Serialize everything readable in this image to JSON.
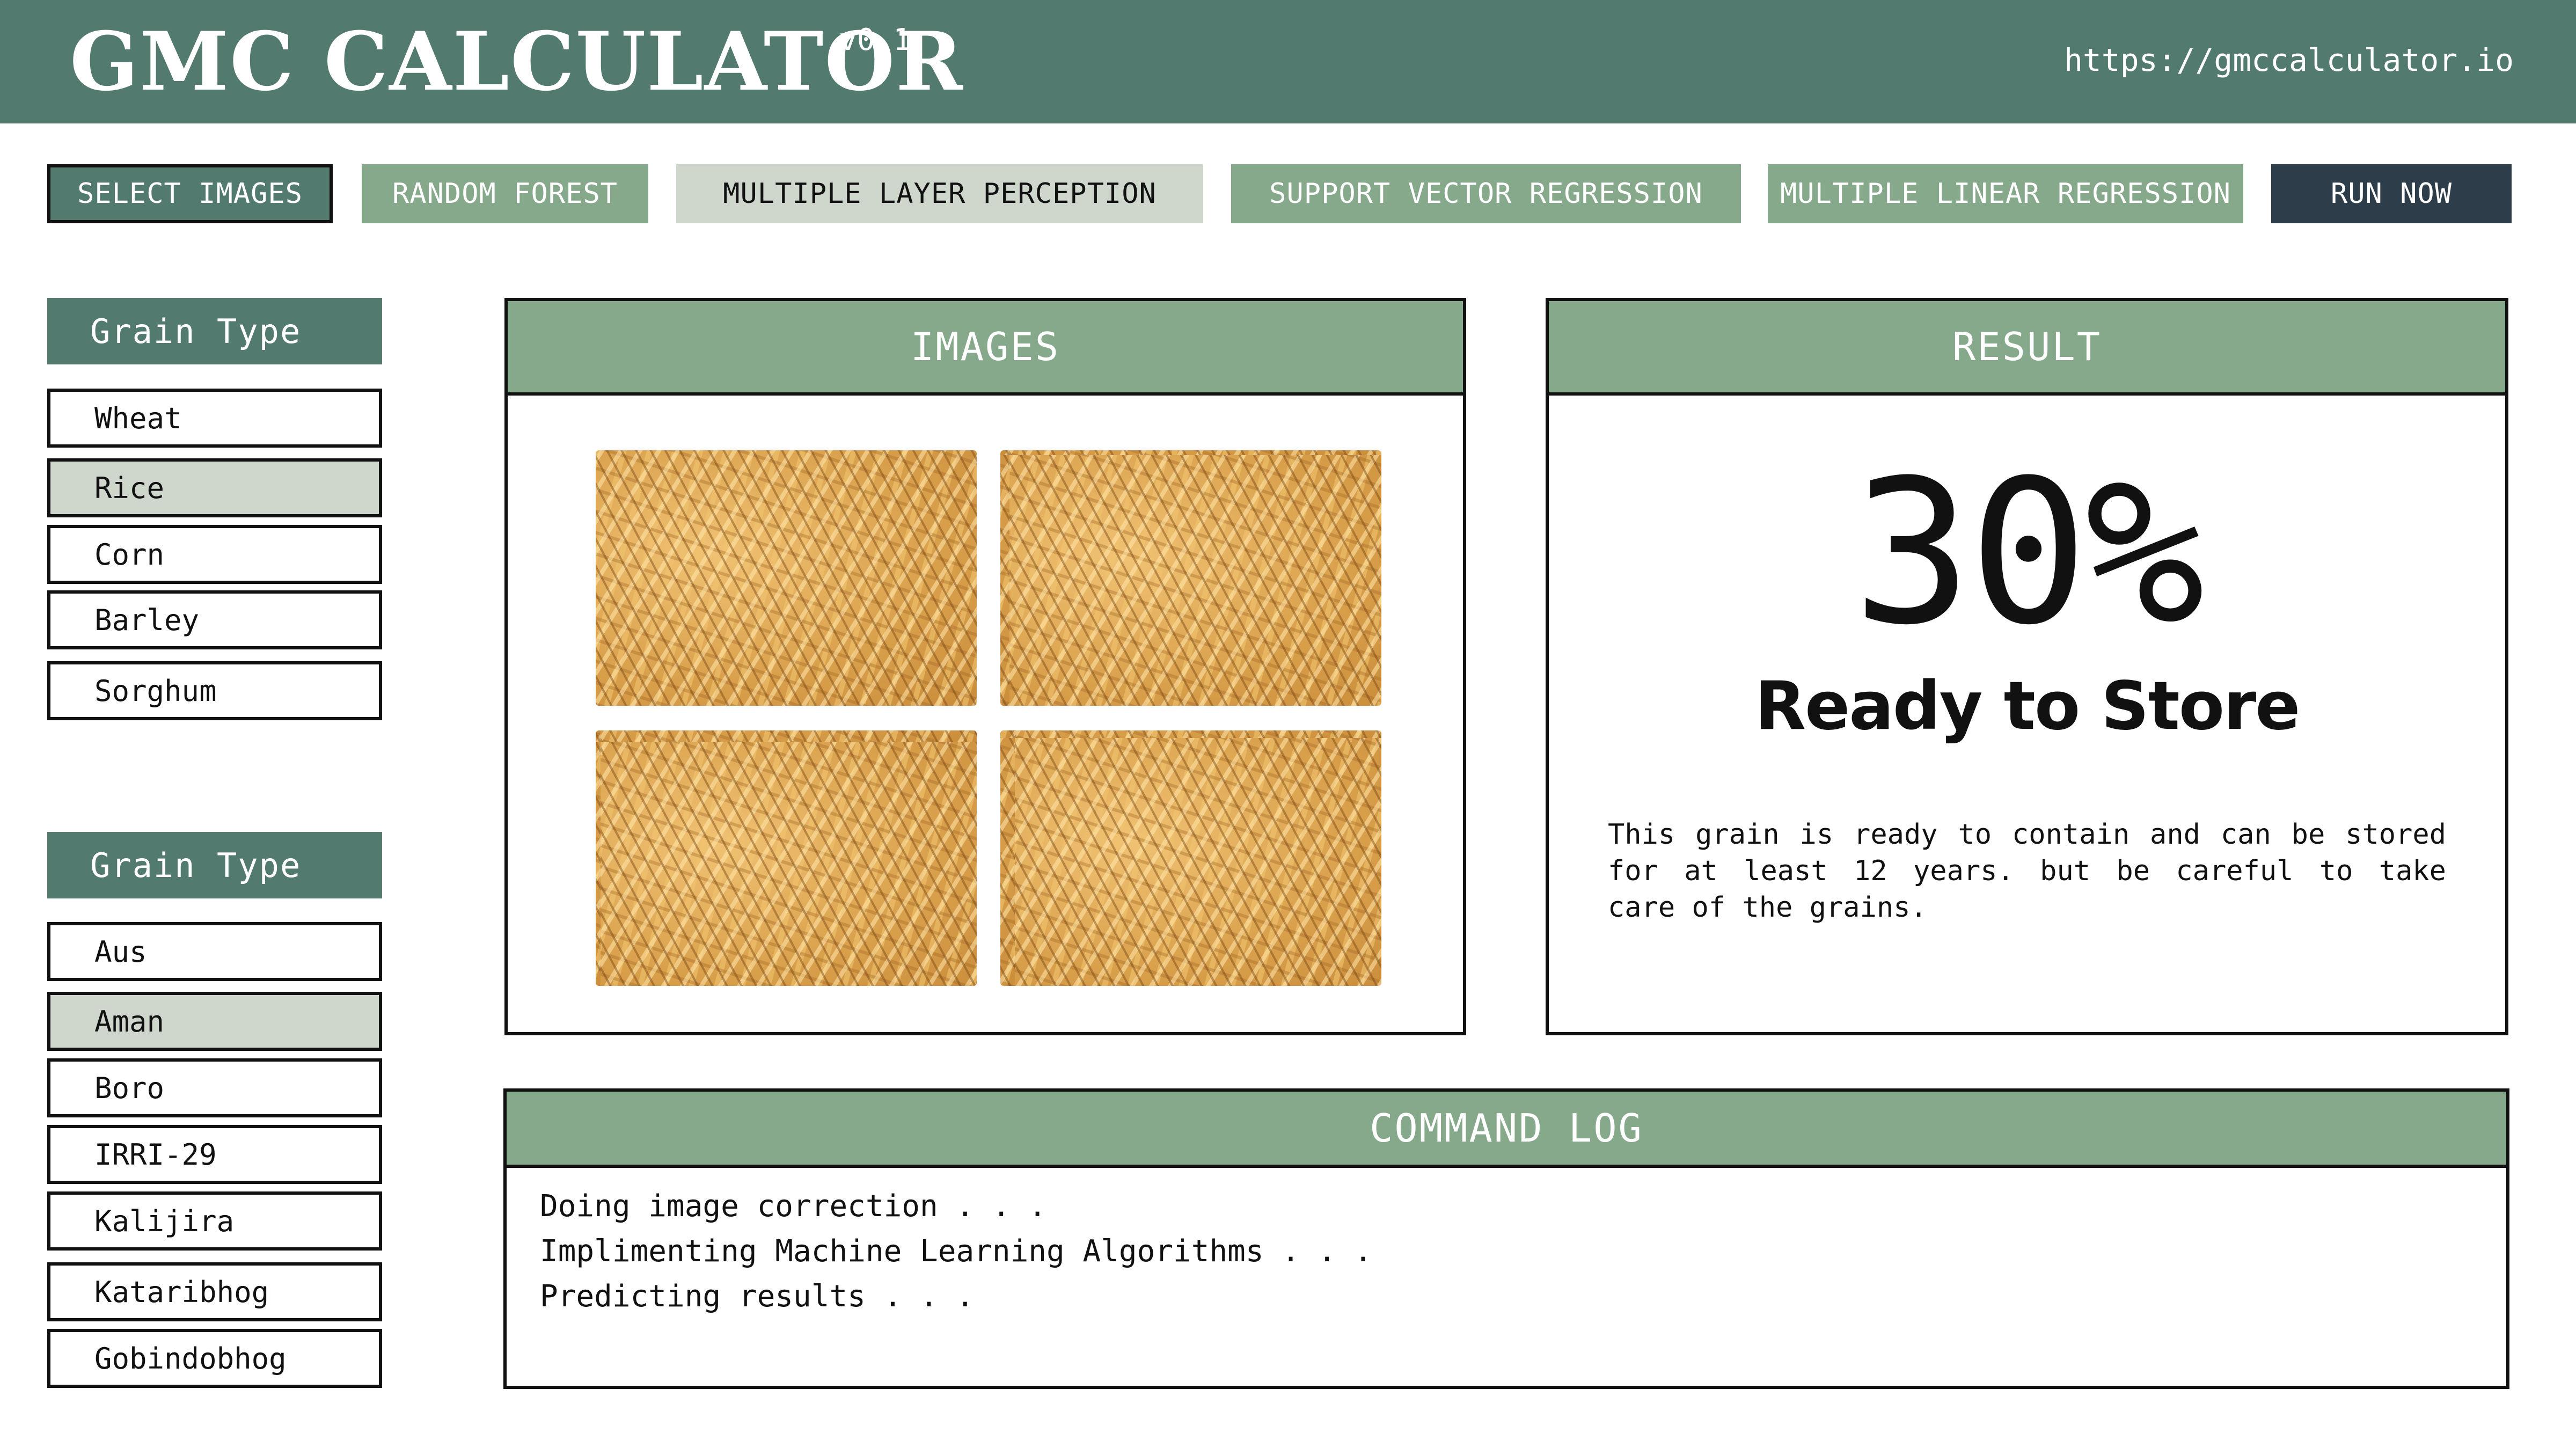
{
  "app": {
    "title": "GMC CALCULATOR",
    "version": "v0.1",
    "url": "https://gmccalculator.io"
  },
  "toolbar": {
    "select_images": "SELECT IMAGES",
    "random_forest": "RANDOM FOREST",
    "mlp": "MULTIPLE LAYER PERCEPTION",
    "svr": "SUPPORT VECTOR REGRESSION",
    "mlr": "MULTIPLE LINEAR REGRESSION",
    "run_now": "RUN NOW"
  },
  "sidebar": {
    "grain_type_header": "Grain Type",
    "grain_types": [
      "Wheat",
      "Rice",
      "Corn",
      "Barley",
      "Sorghum"
    ],
    "grain_types_selected": "Rice",
    "variety_header": "Grain Type",
    "varieties": [
      "Aus",
      "Aman",
      "Boro",
      "IRRI-29",
      "Kalijira",
      "Kataribhog",
      "Gobindobhog"
    ],
    "varieties_selected": "Aman"
  },
  "images_panel": {
    "title": "IMAGES",
    "image_count": 4
  },
  "result_panel": {
    "title": "RESULT",
    "value": "30%",
    "status": "Ready to Store",
    "description": "This grain is ready to contain and can be stored for at least 12 years. but be careful to take care of the grains."
  },
  "command_log": {
    "title": "COMMAND LOG",
    "lines": [
      "Doing image correction . . .",
      "Implimenting Machine Learning Algorithms . . .",
      "Predicting results . . ."
    ]
  },
  "colors": {
    "header_bg": "#527a6f",
    "accent_light": "#86a98b",
    "selected_bg": "#cfd6cc",
    "run_bg": "#2d3e4a"
  }
}
